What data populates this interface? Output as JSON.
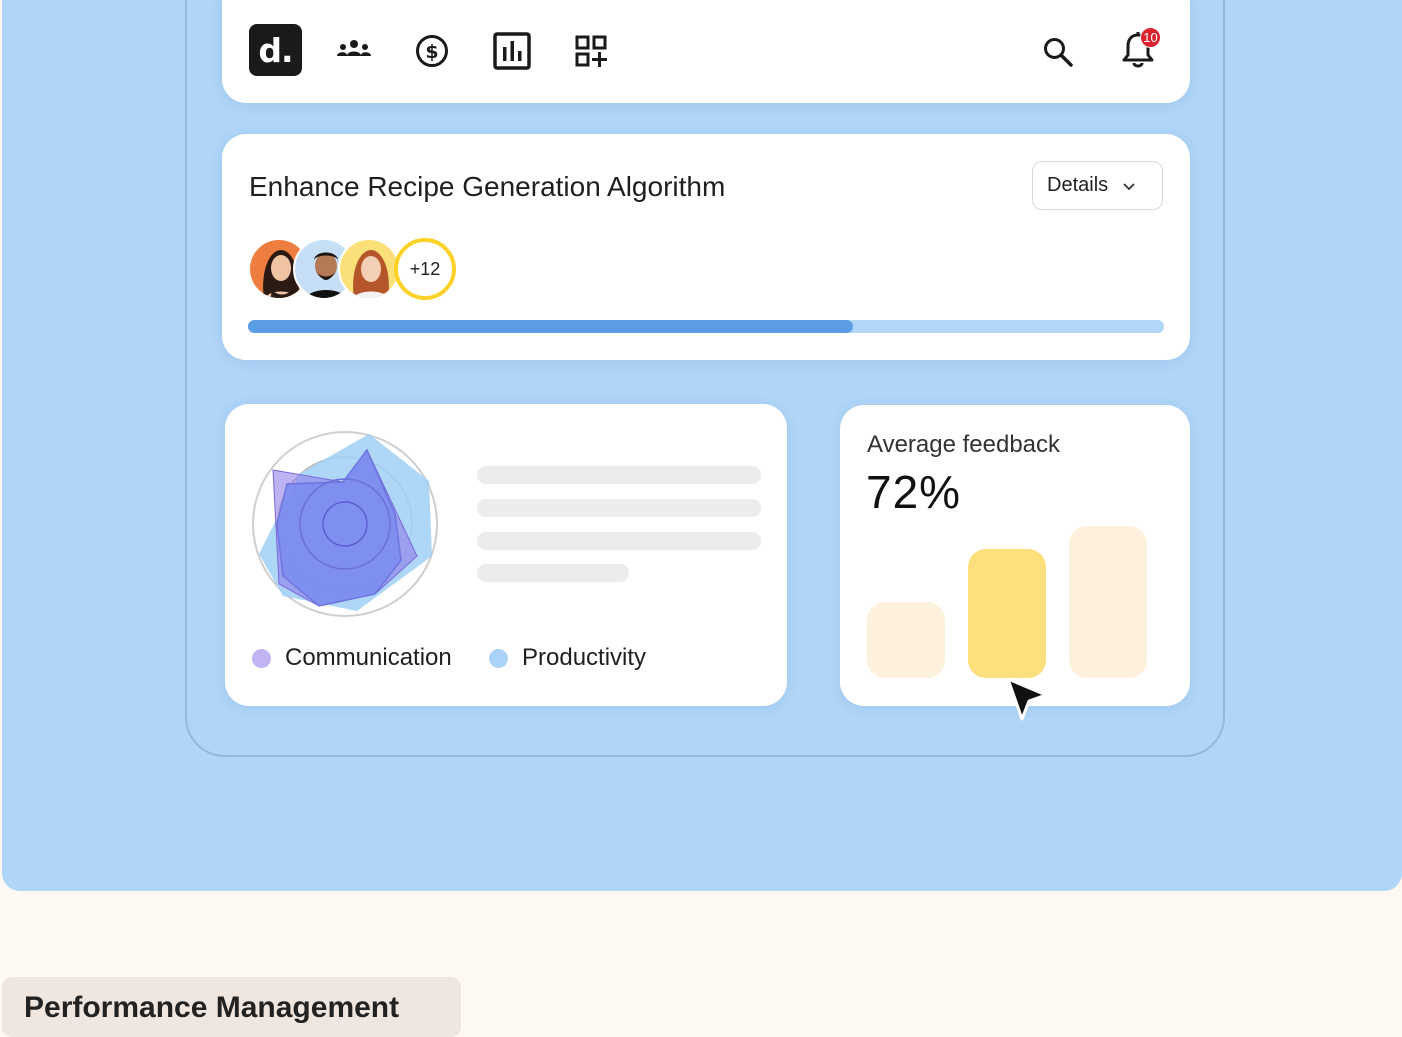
{
  "nav": {
    "logo_text": "d.",
    "icons": [
      "team-icon",
      "dollar-icon",
      "chart-icon",
      "add-widget-icon",
      "search-icon",
      "bell-icon"
    ],
    "notification_count": "10"
  },
  "project": {
    "title": "Enhance Recipe Generation Algorithm",
    "details_label": "Details",
    "extra_members": "+12",
    "progress_fraction": 0.66
  },
  "radar": {
    "legend": [
      {
        "label": "Communication",
        "color": "#c2b3f2"
      },
      {
        "label": "Productivity",
        "color": "#a9d4f7"
      }
    ]
  },
  "feedback": {
    "label": "Average feedback",
    "value": "72%",
    "bars": [
      0.5,
      0.85,
      1.0
    ],
    "bar_colors": [
      "#fdf0dc",
      "#fde07c",
      "#fdf0dc"
    ]
  },
  "footer": {
    "tab_label": "Performance Management"
  }
}
